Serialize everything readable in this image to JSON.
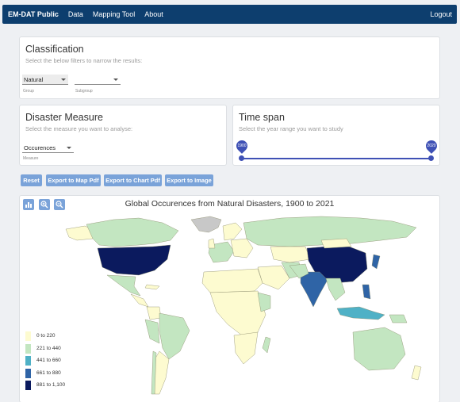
{
  "nav": {
    "brand": "EM-DAT Public",
    "links": [
      "Data",
      "Mapping Tool",
      "About"
    ],
    "logout": "Logout"
  },
  "classification": {
    "title": "Classification",
    "subtitle": "Select the below filters to narrow the results:",
    "group": {
      "value": "Natural",
      "helper": "Group"
    },
    "subgroup": {
      "value": "",
      "helper": "Subgroup"
    }
  },
  "measure": {
    "title": "Disaster Measure",
    "subtitle": "Select the measure you want to analyse:",
    "value": "Occurences",
    "helper": "Measure"
  },
  "timespan": {
    "title": "Time span",
    "subtitle": "Select the year range you want to study",
    "start": "1900",
    "end": "2020"
  },
  "buttons": [
    "Reset",
    "Export to Map Pdf",
    "Export to Chart Pdf",
    "Export to Image"
  ],
  "map": {
    "title": "Global Occurences from Natural Disasters, 1900 to 2021",
    "tools": [
      "bar-chart-icon",
      "zoom-in-icon",
      "zoom-out-icon"
    ],
    "legend": [
      {
        "label": "0 to 220",
        "color": "#fdfbd0"
      },
      {
        "label": "221 to 440",
        "color": "#c3e6c1"
      },
      {
        "label": "441 to 660",
        "color": "#4fb1c6"
      },
      {
        "label": "661 to 880",
        "color": "#2f64a6"
      },
      {
        "label": "881 to 1,100",
        "color": "#0b1a5e"
      }
    ],
    "no_data_color": "#c8c8c8"
  }
}
